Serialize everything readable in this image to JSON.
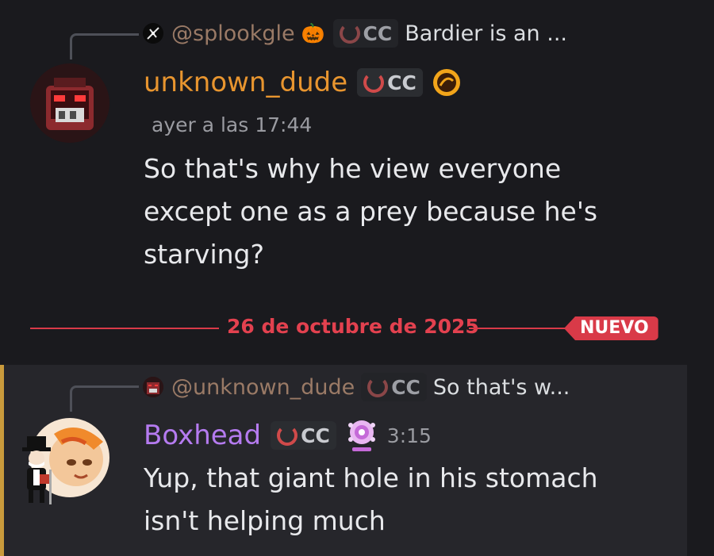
{
  "message1": {
    "reply": {
      "author": "@splookgle",
      "tag": "CC",
      "preview": "Bardier is an ..."
    },
    "username": "unknown_dude",
    "username_color": "#e8952f",
    "tag": "CC",
    "timestamp": "ayer a las 17:44",
    "text": "So that's why he view everyone except one as a prey because he's starving?"
  },
  "divider": {
    "date": "26 de octubre de 2025",
    "badge": "NUEVO"
  },
  "message2": {
    "reply": {
      "author": "@unknown_dude",
      "tag": "CC",
      "preview": "So that's w..."
    },
    "username": "Boxhead",
    "username_color": "#b57bf0",
    "tag": "CC",
    "timestamp": "3:15",
    "text": "Yup, that giant hole in his stomach isn't helping much"
  },
  "colors": {
    "background": "#1a1a1e",
    "accent_red": "#d93a48",
    "highlight_bar": "#c99a3c"
  }
}
